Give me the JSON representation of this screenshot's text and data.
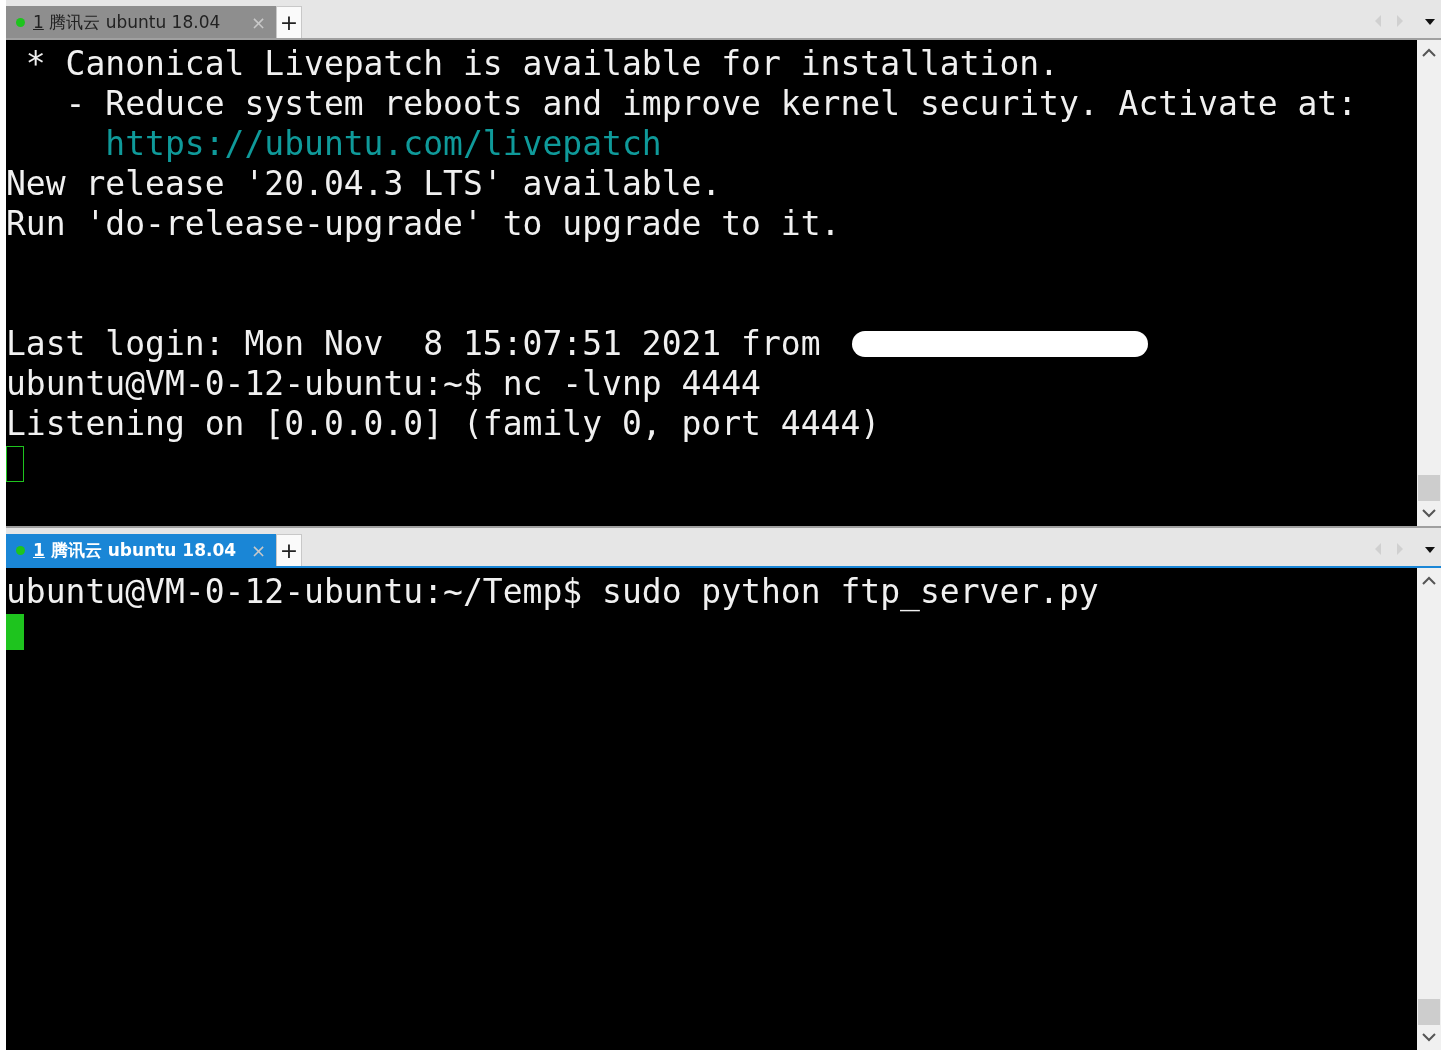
{
  "panes": [
    {
      "tab": {
        "number": "1",
        "title": "腾讯云 ubuntu 18.04",
        "selected": false,
        "connected": true,
        "close": "×",
        "add": "+"
      },
      "lines": [
        {
          "kind": "text",
          "text": " * Canonical Livepatch is available for installation."
        },
        {
          "kind": "text",
          "text": "   - Reduce system reboots and improve kernel security. Activate at:"
        },
        {
          "kind": "link",
          "text": "     https://ubuntu.com/livepatch"
        },
        {
          "kind": "text",
          "text": "New release '20.04.3 LTS' available."
        },
        {
          "kind": "text",
          "text": "Run 'do-release-upgrade' to upgrade to it."
        },
        {
          "kind": "blank"
        },
        {
          "kind": "blank"
        },
        {
          "kind": "text",
          "text": "Last login: Mon Nov  8 15:07:51 2021 from ",
          "redacted": true
        },
        {
          "kind": "text",
          "text": "ubuntu@VM-0-12-ubuntu:~$ nc -lvnp 4444"
        },
        {
          "kind": "text",
          "text": "Listening on [0.0.0.0] (family 0, port 4444)"
        },
        {
          "kind": "cursor"
        }
      ]
    },
    {
      "tab": {
        "number": "1",
        "title": "腾讯云 ubuntu 18.04",
        "selected": true,
        "connected": true,
        "close": "×",
        "add": "+"
      },
      "lines": [
        {
          "kind": "text",
          "text": "ubuntu@VM-0-12-ubuntu:~/Temp$ sudo python ftp_server.py"
        },
        {
          "kind": "cursor"
        }
      ]
    }
  ]
}
